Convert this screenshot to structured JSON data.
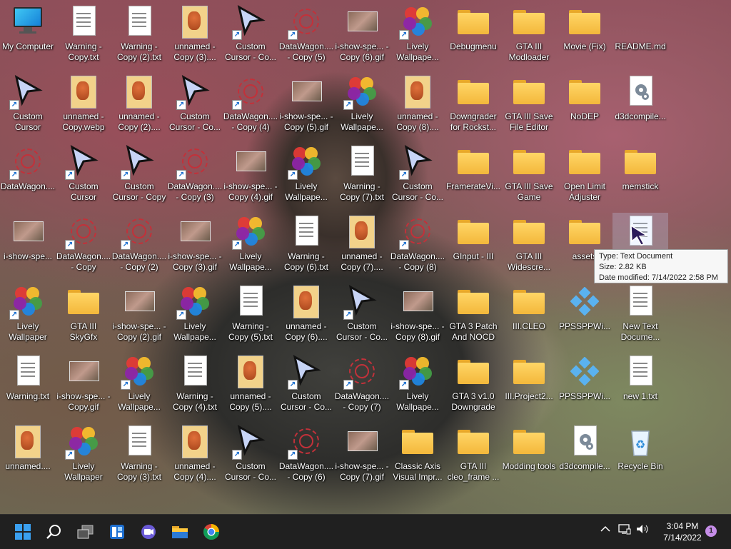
{
  "desktop": {
    "icons": [
      {
        "label": "My Computer",
        "type": "pc",
        "shortcut": false
      },
      {
        "label": "Warning - Copy.txt",
        "type": "doc",
        "shortcut": false
      },
      {
        "label": "Warning - Copy (2).txt",
        "type": "doc",
        "shortcut": false
      },
      {
        "label": "unnamed - Copy (3)....",
        "type": "gif",
        "shortcut": false
      },
      {
        "label": "Custom Cursor - Co...",
        "type": "cursor",
        "shortcut": true
      },
      {
        "label": "DataWagon.... - Copy (5)",
        "type": "rose",
        "shortcut": true
      },
      {
        "label": "i-show-spe... - Copy (6).gif",
        "type": "thumb",
        "shortcut": false
      },
      {
        "label": "Lively Wallpape...",
        "type": "lively",
        "shortcut": true
      },
      {
        "label": "Debugmenu",
        "type": "folder",
        "shortcut": false
      },
      {
        "label": "GTA III Modloader",
        "type": "folder",
        "shortcut": false
      },
      {
        "label": "Movie (Fix)",
        "type": "folder",
        "shortcut": false
      },
      {
        "label": "README.md",
        "type": "blank",
        "shortcut": false
      },
      {
        "label": "Custom Cursor",
        "type": "cursor",
        "shortcut": true
      },
      {
        "label": "unnamed - Copy.webp",
        "type": "gif",
        "shortcut": false
      },
      {
        "label": "unnamed - Copy (2)....",
        "type": "gif",
        "shortcut": false
      },
      {
        "label": "Custom Cursor - Co...",
        "type": "cursor",
        "shortcut": true
      },
      {
        "label": "DataWagon.... - Copy (4)",
        "type": "rose",
        "shortcut": true
      },
      {
        "label": "i-show-spe... - Copy (5).gif",
        "type": "thumb",
        "shortcut": false
      },
      {
        "label": "Lively Wallpape...",
        "type": "lively",
        "shortcut": true
      },
      {
        "label": "unnamed - Copy (8)....",
        "type": "gif",
        "shortcut": false
      },
      {
        "label": "Downgrader for Rockst...",
        "type": "folder",
        "shortcut": false
      },
      {
        "label": "GTA III Save File Editor",
        "type": "folder",
        "shortcut": false
      },
      {
        "label": "NoDEP",
        "type": "folder",
        "shortcut": false
      },
      {
        "label": "d3dcompile...",
        "type": "gear",
        "shortcut": false
      },
      {
        "label": "DataWagon....",
        "type": "rose",
        "shortcut": true
      },
      {
        "label": "Custom Cursor",
        "type": "cursor",
        "shortcut": true
      },
      {
        "label": "Custom Cursor - Copy",
        "type": "cursor",
        "shortcut": true
      },
      {
        "label": "DataWagon.... - Copy (3)",
        "type": "rose",
        "shortcut": true
      },
      {
        "label": "i-show-spe... - Copy (4).gif",
        "type": "thumb",
        "shortcut": false
      },
      {
        "label": "Lively Wallpape...",
        "type": "lively",
        "shortcut": true
      },
      {
        "label": "Warning - Copy (7).txt",
        "type": "doc",
        "shortcut": false
      },
      {
        "label": "Custom Cursor - Co...",
        "type": "cursor",
        "shortcut": true
      },
      {
        "label": "FramerateVi...",
        "type": "folder",
        "shortcut": false
      },
      {
        "label": "GTA III Save Game",
        "type": "folder",
        "shortcut": false
      },
      {
        "label": "Open Limit Adjuster",
        "type": "folder",
        "shortcut": false
      },
      {
        "label": "memstick",
        "type": "folder",
        "shortcut": false
      },
      {
        "label": "i-show-spe...",
        "type": "thumb",
        "shortcut": false
      },
      {
        "label": "DataWagon.... - Copy",
        "type": "rose",
        "shortcut": true
      },
      {
        "label": "DataWagon.... - Copy (2)",
        "type": "rose",
        "shortcut": true
      },
      {
        "label": "i-show-spe... - Copy (3).gif",
        "type": "thumb",
        "shortcut": false
      },
      {
        "label": "Lively Wallpape...",
        "type": "lively",
        "shortcut": true
      },
      {
        "label": "Warning - Copy (6).txt",
        "type": "doc",
        "shortcut": false
      },
      {
        "label": "unnamed - Copy (7)....",
        "type": "gif",
        "shortcut": false
      },
      {
        "label": "DataWagon.... - Copy (8)",
        "type": "rose",
        "shortcut": true
      },
      {
        "label": "GInput - III",
        "type": "folder",
        "shortcut": false
      },
      {
        "label": "GTA III Widescre...",
        "type": "folder",
        "shortcut": false
      },
      {
        "label": "assets",
        "type": "folder",
        "shortcut": false
      },
      {
        "label": "",
        "type": "doc",
        "shortcut": false
      },
      {
        "label": "Lively Wallpaper",
        "type": "lively",
        "shortcut": true
      },
      {
        "label": "GTA III SkyGfx",
        "type": "folder",
        "shortcut": false
      },
      {
        "label": "i-show-spe... - Copy (2).gif",
        "type": "thumb",
        "shortcut": false
      },
      {
        "label": "Lively Wallpape...",
        "type": "lively",
        "shortcut": true
      },
      {
        "label": "Warning - Copy (5).txt",
        "type": "doc",
        "shortcut": false
      },
      {
        "label": "unnamed - Copy (6)....",
        "type": "gif",
        "shortcut": false
      },
      {
        "label": "Custom Cursor - Co...",
        "type": "cursor",
        "shortcut": true
      },
      {
        "label": "i-show-spe... - Copy (8).gif",
        "type": "thumb",
        "shortcut": false
      },
      {
        "label": "GTA 3 Patch And NOCD",
        "type": "folder",
        "shortcut": false
      },
      {
        "label": "III.CLEO",
        "type": "folder",
        "shortcut": false
      },
      {
        "label": "PPSSPPWi...",
        "type": "ppsspp",
        "shortcut": false
      },
      {
        "label": "New Text Docume...",
        "type": "doc",
        "shortcut": false
      },
      {
        "label": "Warning.txt",
        "type": "doc",
        "shortcut": false
      },
      {
        "label": "i-show-spe... - Copy.gif",
        "type": "thumb",
        "shortcut": false
      },
      {
        "label": "Lively Wallpape...",
        "type": "lively",
        "shortcut": true
      },
      {
        "label": "Warning - Copy (4).txt",
        "type": "doc",
        "shortcut": false
      },
      {
        "label": "unnamed - Copy (5)....",
        "type": "gif",
        "shortcut": false
      },
      {
        "label": "Custom Cursor - Co...",
        "type": "cursor",
        "shortcut": true
      },
      {
        "label": "DataWagon.... - Copy (7)",
        "type": "rose",
        "shortcut": true
      },
      {
        "label": "Lively Wallpape...",
        "type": "lively",
        "shortcut": true
      },
      {
        "label": "GTA 3 v1.0 Downgrade",
        "type": "folder",
        "shortcut": false
      },
      {
        "label": "III.Project2...",
        "type": "folder",
        "shortcut": false
      },
      {
        "label": "PPSSPPWi...",
        "type": "ppsspp",
        "shortcut": false
      },
      {
        "label": "new 1.txt",
        "type": "doc",
        "shortcut": false
      },
      {
        "label": "unnamed....",
        "type": "gif",
        "shortcut": false
      },
      {
        "label": "Lively Wallpaper",
        "type": "lively",
        "shortcut": true
      },
      {
        "label": "Warning - Copy (3).txt",
        "type": "doc",
        "shortcut": false
      },
      {
        "label": "unnamed - Copy (4)....",
        "type": "gif",
        "shortcut": false
      },
      {
        "label": "Custom Cursor - Co...",
        "type": "cursor",
        "shortcut": true
      },
      {
        "label": "DataWagon.... - Copy (6)",
        "type": "rose",
        "shortcut": true
      },
      {
        "label": "i-show-spe... - Copy (7).gif",
        "type": "thumb",
        "shortcut": false
      },
      {
        "label": "Classic Axis Visual Impr...",
        "type": "folder",
        "shortcut": false
      },
      {
        "label": "GTA III cleo_frame ...",
        "type": "folder",
        "shortcut": false
      },
      {
        "label": "Modding tools",
        "type": "folder",
        "shortcut": false
      },
      {
        "label": "d3dcompile...",
        "type": "gear",
        "shortcut": false
      },
      {
        "label": "Recycle Bin",
        "type": "recycle",
        "shortcut": false
      }
    ]
  },
  "tooltip": {
    "type": "Type: Text Document",
    "size": "Size: 2.82 KB",
    "modified": "Date modified: 7/14/2022 2:58 PM"
  },
  "taskbar": {
    "apps": [
      {
        "name": "start-button",
        "icon": "windows-logo-icon"
      },
      {
        "name": "search-button",
        "icon": "search-icon"
      },
      {
        "name": "task-view-button",
        "icon": "task-view-icon"
      },
      {
        "name": "widgets-button",
        "icon": "widgets-icon"
      },
      {
        "name": "teams-chat-button",
        "icon": "video-chat-icon"
      },
      {
        "name": "file-explorer-button",
        "icon": "folder-icon"
      },
      {
        "name": "chrome-button",
        "icon": "chrome-icon"
      }
    ],
    "clock": {
      "time": "3:04 PM",
      "date": "7/14/2022"
    },
    "notification_count": "1"
  },
  "colors": {
    "taskbar": "#202020",
    "accent": "#0078d4",
    "folder": "#ffd666"
  }
}
